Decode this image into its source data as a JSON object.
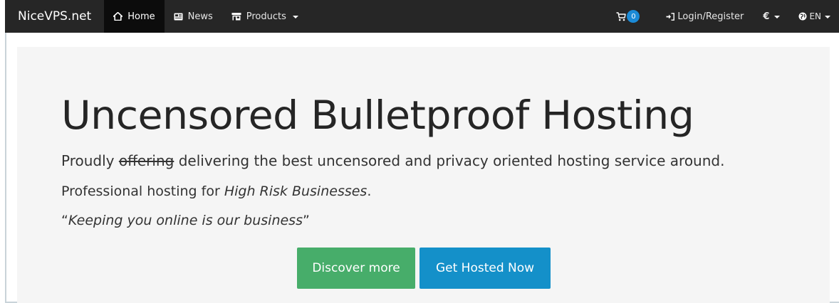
{
  "navbar": {
    "brand": "NiceVPS.net",
    "items": [
      {
        "label": "Home",
        "icon": "home-icon",
        "active": true
      },
      {
        "label": "News",
        "icon": "newspaper-icon"
      },
      {
        "label": "Products",
        "icon": "store-icon",
        "dropdown": true
      }
    ],
    "cart_count": "0",
    "login_label": "Login/Register",
    "currency_label": "€",
    "language_label": "EN",
    "colors": {
      "bar": "#262626",
      "active": "#0c0c0c",
      "badge": "#1b8ad6"
    }
  },
  "hero": {
    "title": "Uncensored Bulletproof Hosting",
    "line1_prefix": "Proudly ",
    "line1_struck": "offering",
    "line1_rest": " delivering the best uncensored and privacy oriented hosting service around.",
    "line2_prefix": "Professional hosting for ",
    "line2_italic": "High Risk Businesses",
    "line2_suffix": ".",
    "quote_open": "“",
    "quote_text": "Keeping you online is our business",
    "quote_close": "”",
    "buttons": {
      "discover": "Discover more",
      "hosted": "Get Hosted Now"
    },
    "colors": {
      "discover": "#47ad6a",
      "hosted": "#1490c9",
      "background": "#f5f5f5"
    }
  }
}
